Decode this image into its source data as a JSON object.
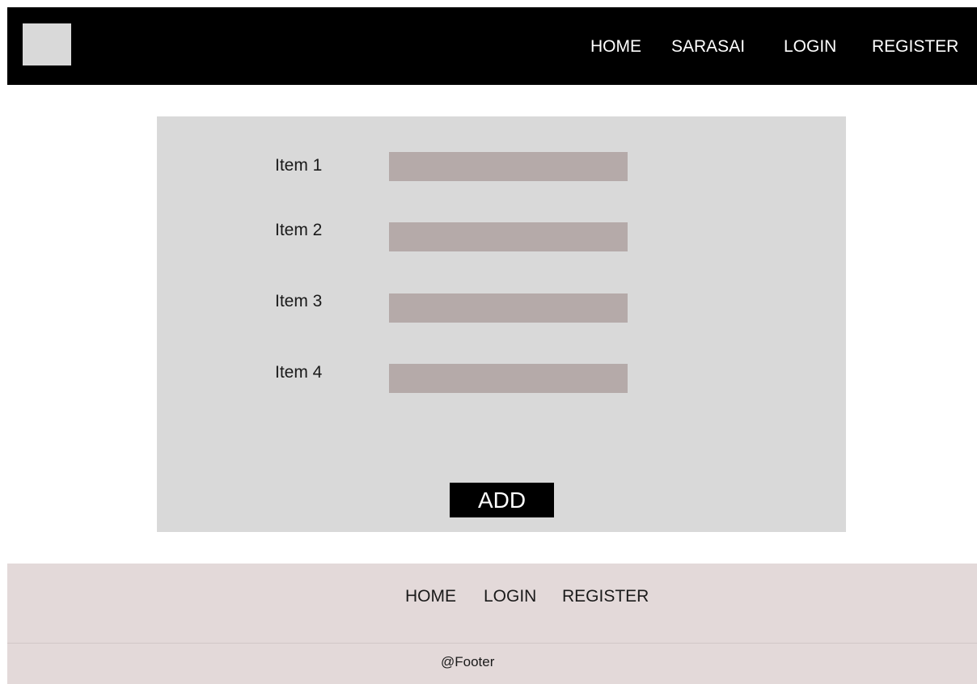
{
  "header": {
    "logo": "logo-placeholder",
    "nav": [
      {
        "label": "HOME"
      },
      {
        "label": "SARASAI"
      },
      {
        "label": "LOGIN"
      },
      {
        "label": "REGISTER"
      }
    ]
  },
  "form": {
    "items": [
      {
        "label": "Item 1",
        "value": ""
      },
      {
        "label": "Item 2",
        "value": ""
      },
      {
        "label": "Item 3",
        "value": ""
      },
      {
        "label": "Item 4",
        "value": ""
      }
    ],
    "add_label": "ADD"
  },
  "footer": {
    "nav": [
      {
        "label": "HOME"
      },
      {
        "label": "LOGIN"
      },
      {
        "label": "REGISTER"
      }
    ],
    "copyright": "@Footer"
  },
  "colors": {
    "header_bg": "#000000",
    "panel_bg": "#d9d9d9",
    "input_bg": "#b5aaa9",
    "footer_bg": "#e3d9d9",
    "button_bg": "#000000"
  }
}
